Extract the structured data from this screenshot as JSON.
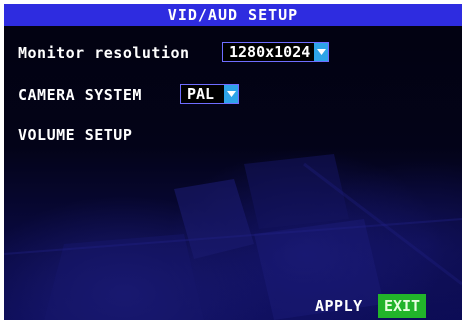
{
  "header": {
    "title": "VID/AUD SETUP"
  },
  "monitor_resolution": {
    "label": "Monitor resolution",
    "value": "1280x1024"
  },
  "camera_system": {
    "label": "CAMERA SYSTEM",
    "value": "PAL"
  },
  "volume_setup": {
    "label": "VOLUME SETUP"
  },
  "footer": {
    "apply_label": "APPLY",
    "exit_label": "EXIT"
  },
  "colors": {
    "title_bar": "#2e2ce0",
    "dropdown_arrow": "#2ea4e8",
    "exit_button": "#22b42a"
  },
  "icons": [
    "chevron-down-icon"
  ]
}
